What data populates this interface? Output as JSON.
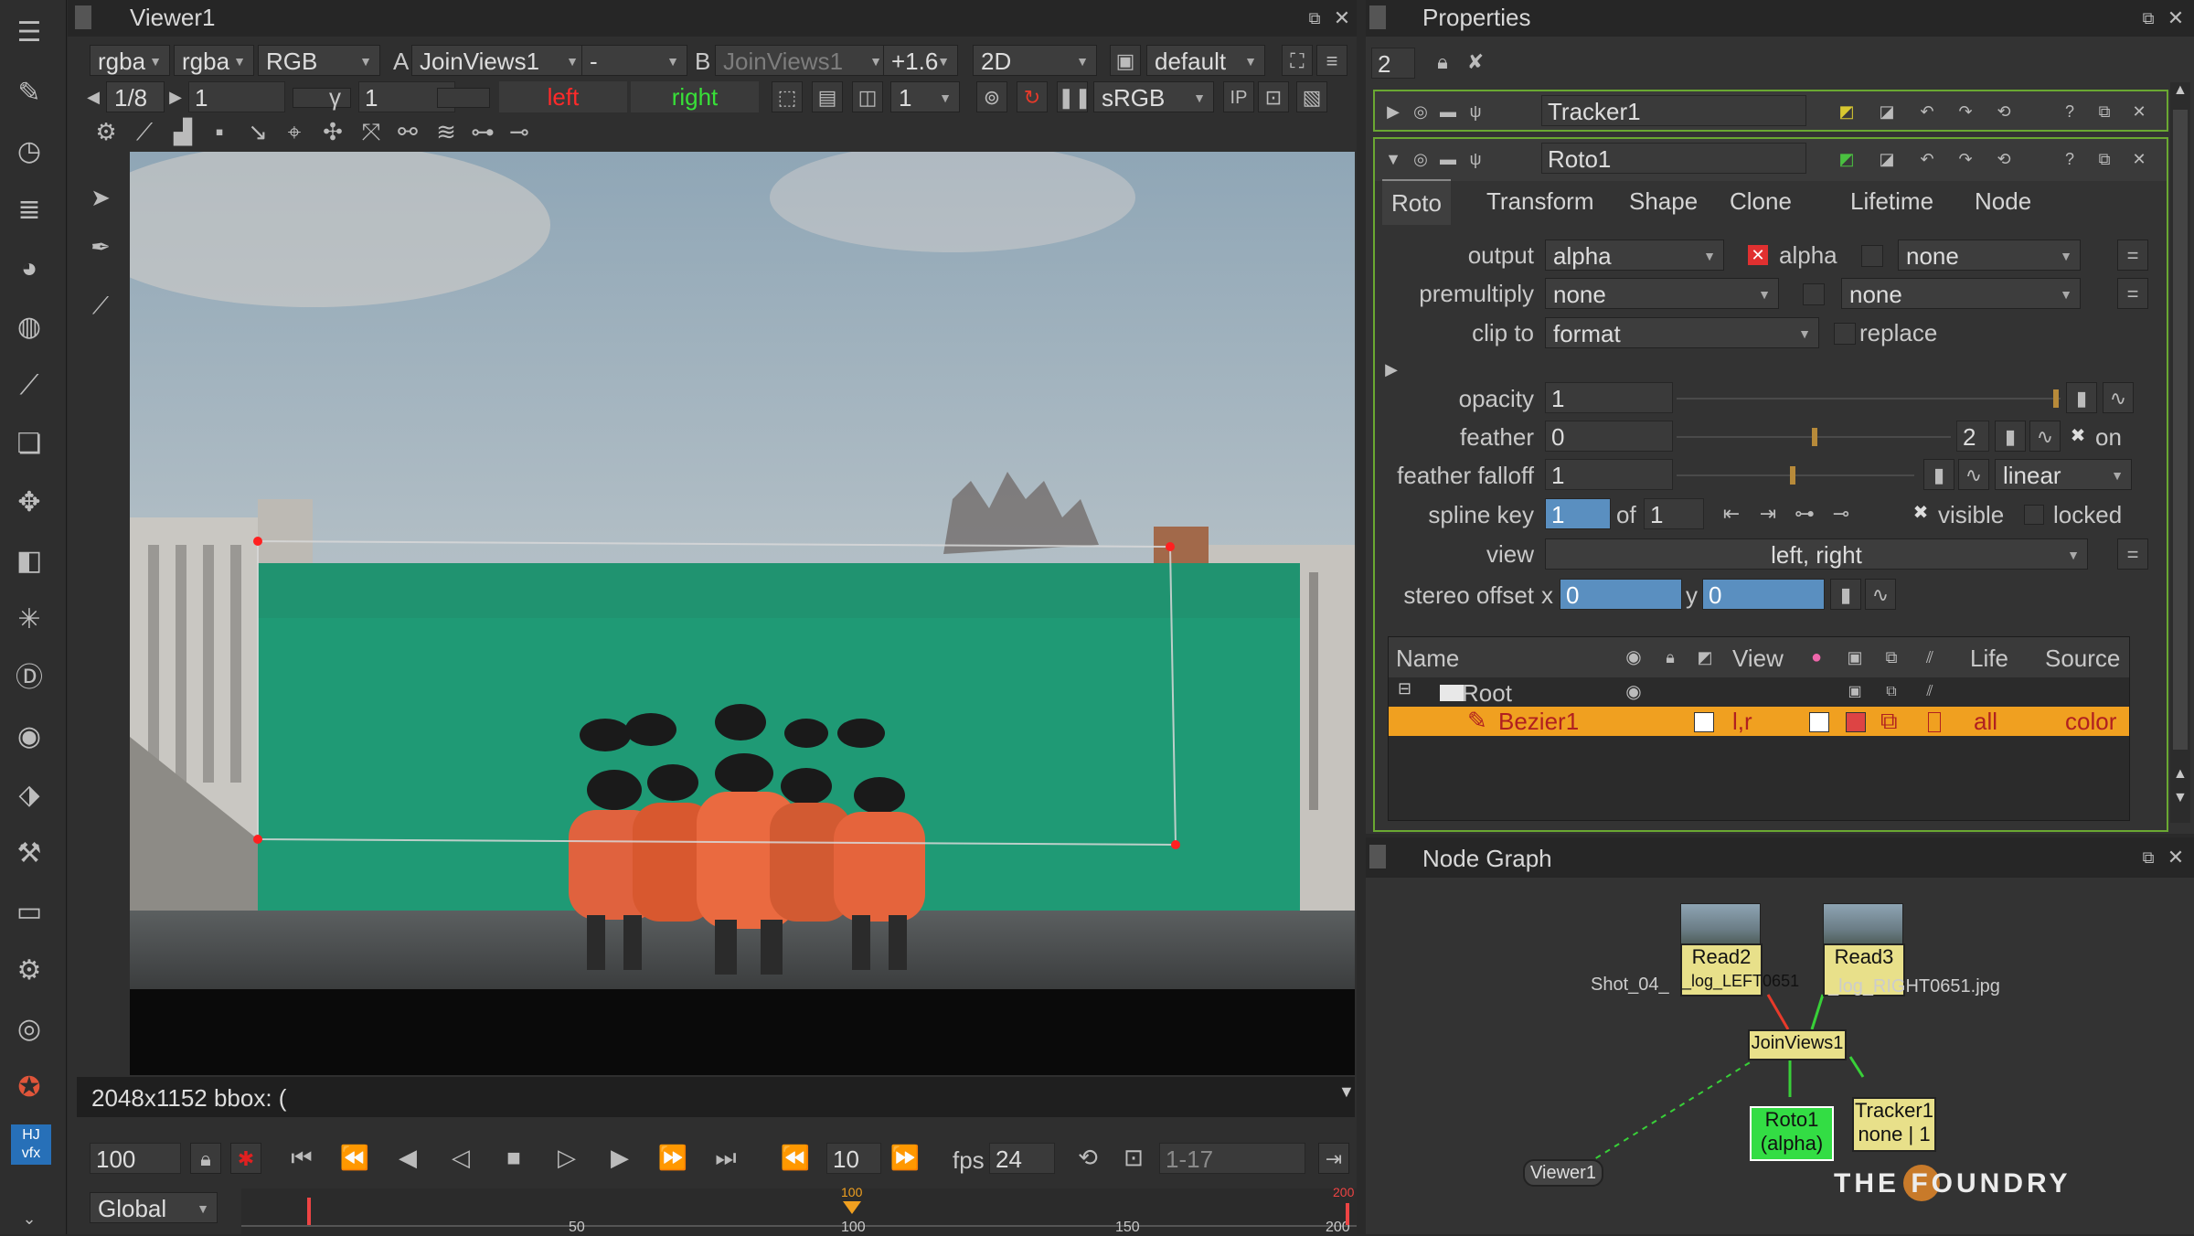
{
  "viewer": {
    "tab_title": "Viewer1",
    "toolbar1": {
      "channels_a": "rgba",
      "channels_b": "rgba",
      "channel_mode": "RGB",
      "input_a_label": "A",
      "input_a": "JoinViews1",
      "dash": "-",
      "input_b_label": "B",
      "input_b": "JoinViews1",
      "gain": "+1.6",
      "view_mode": "2D",
      "lut": "default"
    },
    "toolbar2": {
      "proxy": "1/8",
      "frame": "1",
      "gamma_label": "γ",
      "gamma": "1",
      "view_left": "left",
      "view_right": "right",
      "downscale": "1",
      "colorspace": "sRGB",
      "ip_label": "IP"
    },
    "info_bar": "2048x1152 bbox: (",
    "timeline": {
      "start_field": "100",
      "frame_field": "10",
      "fps_label": "fps",
      "fps_value": "24",
      "range": "1-17",
      "scope": "Global",
      "ruler_labels": [
        "50",
        "100",
        "150",
        "200"
      ],
      "playhead_label": "100",
      "end_marker": "200"
    }
  },
  "properties": {
    "tab_title": "Properties",
    "count": "2",
    "tracker_node": "Tracker1",
    "roto_node": "Roto1",
    "tabs": [
      "Roto",
      "Transform",
      "Shape",
      "Clone",
      "Lifetime",
      "Node"
    ],
    "output_label": "output",
    "output_value": "alpha",
    "output_alpha_check": "alpha",
    "output_extra": "none",
    "premultiply_label": "premultiply",
    "premultiply_value": "none",
    "premultiply_extra": "none",
    "clipto_label": "clip to",
    "clipto_value": "format",
    "replace_label": "replace",
    "opacity_label": "opacity",
    "opacity_value": "1",
    "feather_label": "feather",
    "feather_value": "0",
    "feather_num": "2",
    "feather_on": "on",
    "falloff_label": "feather falloff",
    "falloff_value": "1",
    "falloff_type": "linear",
    "splinekey_label": "spline key",
    "splinekey_value": "1",
    "splinekey_of": "of",
    "splinekey_total": "1",
    "visible_label": "visible",
    "locked_label": "locked",
    "view_label": "view",
    "view_value": "left, right",
    "stereo_label": "stereo offset",
    "stereo_x_label": "x",
    "stereo_x": "0",
    "stereo_y_label": "y",
    "stereo_y": "0",
    "table": {
      "headers": {
        "name": "Name",
        "view": "View",
        "life": "Life",
        "source": "Source"
      },
      "root": "Root",
      "bezier": {
        "name": "Bezier1",
        "view": "l,r",
        "life": "all",
        "source": "color"
      }
    }
  },
  "node_graph": {
    "tab_title": "Node Graph",
    "read2": "Read2",
    "read2_sub": "_log_LEFT0651",
    "read2_file": "Shot_04_",
    "read3": "Read3",
    "read3_sub": "_log_RIGHT0651.jpg",
    "joinviews": "JoinViews1",
    "roto": "Roto1",
    "roto_sub": "(alpha)",
    "tracker": "Tracker1",
    "tracker_sub": "none | 1",
    "viewer": "Viewer1",
    "brand": "THE FOUNDRY"
  },
  "colors": {
    "accent_orange": "#f0a020",
    "roto_green": "#33dd44",
    "node_yellow": "#e8e08a",
    "left_red": "#ff2a2a",
    "right_green": "#38e038"
  }
}
